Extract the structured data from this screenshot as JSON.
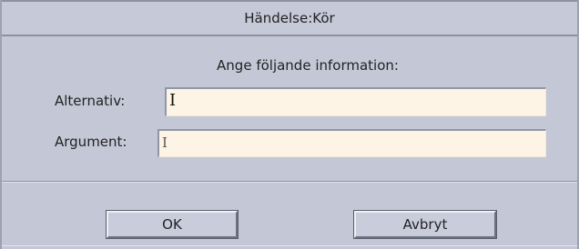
{
  "dialog": {
    "title": "Händelse:Kör",
    "prompt": "Ange följande information:",
    "fields": [
      {
        "label": "Alternativ:",
        "value": "",
        "cursor": "I"
      },
      {
        "label": "Argument:",
        "value": "",
        "cursor": "I"
      }
    ],
    "buttons": {
      "ok": "OK",
      "cancel": "Avbryt"
    }
  },
  "colors": {
    "window_bg": "#c4c8d6",
    "field_bg": "#fdf4e6",
    "border_dark": "#8e92a0"
  }
}
